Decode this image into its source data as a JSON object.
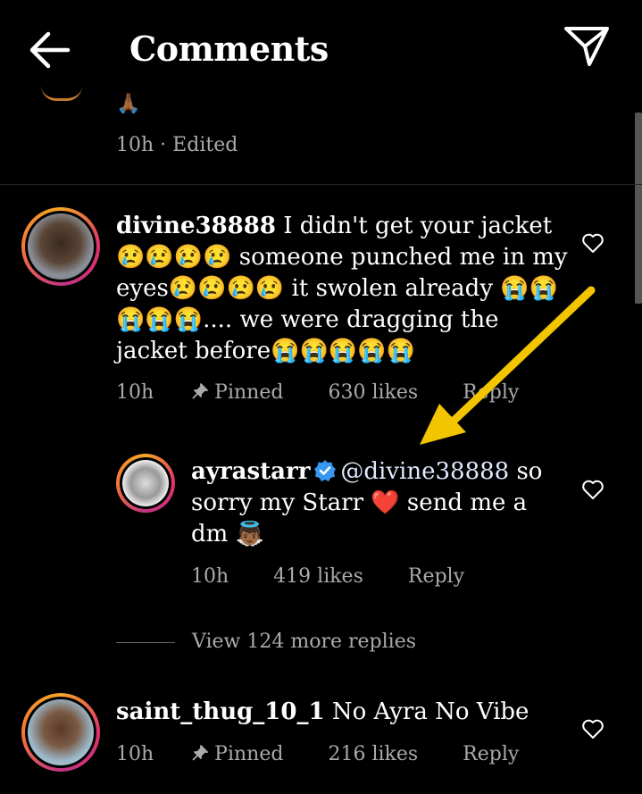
{
  "header": {
    "title": "Comments"
  },
  "previous_comment": {
    "emoji": "🙏🏾",
    "time": "10h",
    "edited": "Edited",
    "separator": "·"
  },
  "comments": [
    {
      "username": "divine38888",
      "text": "I didn't get your jacket 😢😢😢😢 someone punched me in my eyes😢😢😢😢 it swolen already 😭😭😭😭😭.... we were dragging the jacket before😭😭😭😭😭",
      "time": "10h",
      "pinned": "Pinned",
      "likes": "630 likes",
      "reply": "Reply",
      "reply_item": {
        "username": "ayrastarr",
        "mention": "@divine38888",
        "text_after_mention": "so sorry my Starr ❤️ send me a dm 👼🏾",
        "time": "10h",
        "likes": "419 likes",
        "reply": "Reply"
      },
      "view_more": "View 124 more replies"
    },
    {
      "username": "saint_thug_10_1",
      "text": "No Ayra No Vibe",
      "time": "10h",
      "pinned": "Pinned",
      "likes": "216 likes",
      "reply": "Reply"
    }
  ],
  "colors": {
    "background": "#000000",
    "meta": "#aaaaaa",
    "arrow": "#f2c500",
    "verified": "#3897f0"
  }
}
